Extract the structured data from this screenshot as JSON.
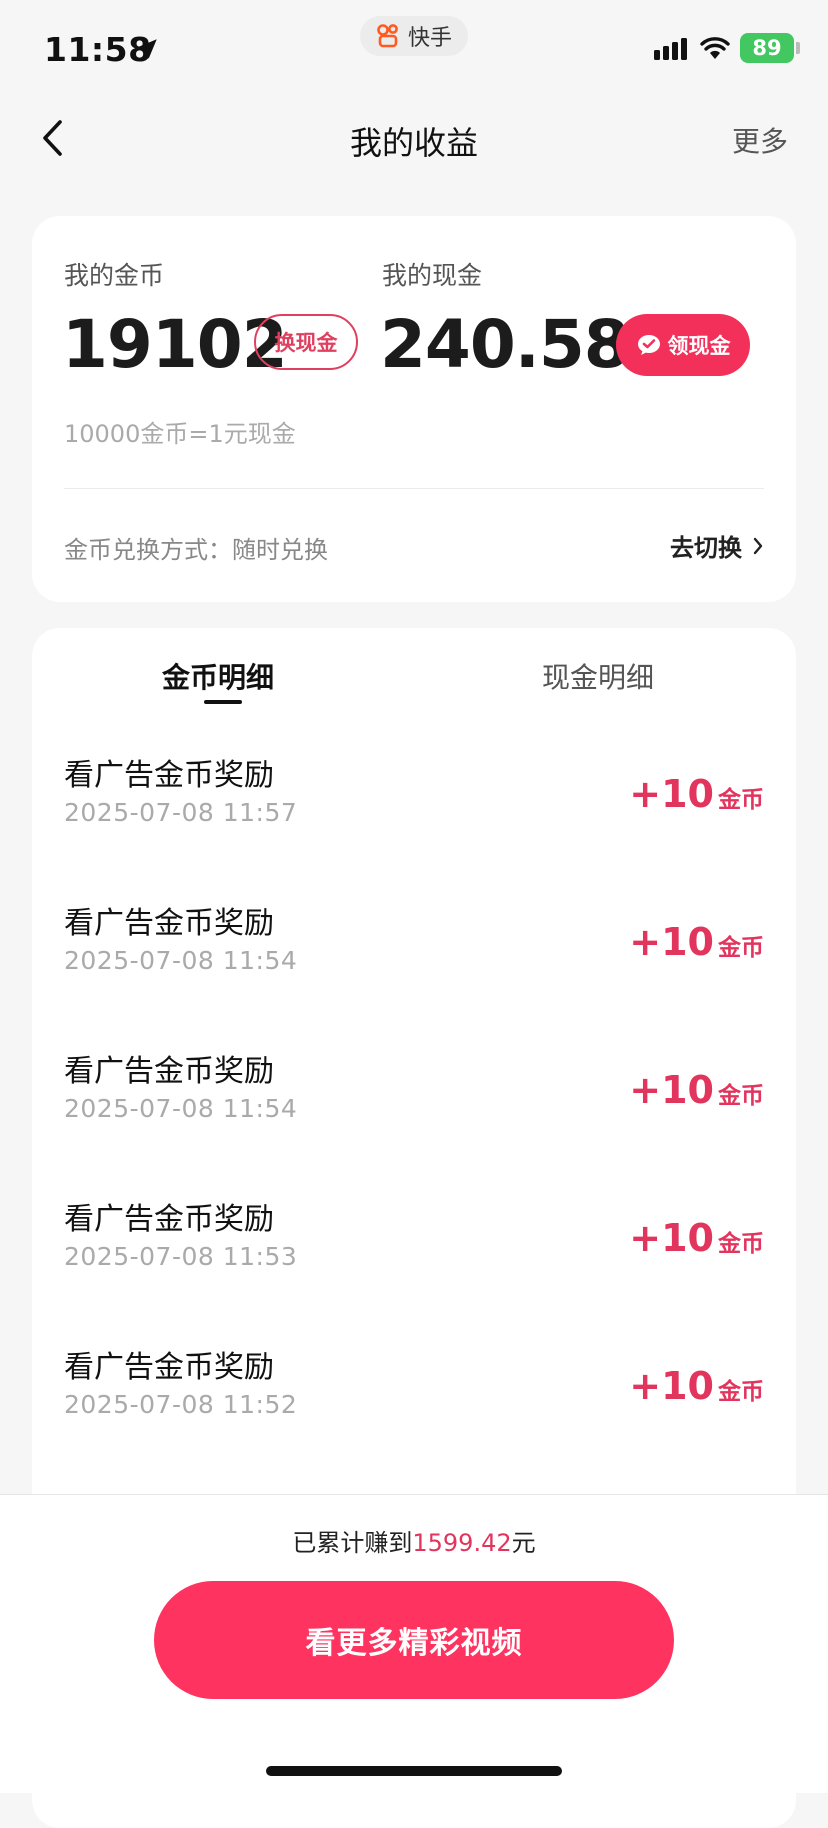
{
  "status_bar": {
    "time": "11:58",
    "app_name": "快手",
    "battery": "89"
  },
  "nav": {
    "title": "我的收益",
    "more": "更多"
  },
  "summary": {
    "coins_label": "我的金币",
    "coins_value": "19102",
    "exchange_btn": "换现金",
    "cash_label": "我的现金",
    "cash_value": "240.58",
    "withdraw_btn": "领现金",
    "rate_text": "10000金币=1元现金",
    "method_text": "金币兑换方式：随时兑换",
    "switch_text": "去切换"
  },
  "tabs": {
    "coins": "金币明细",
    "cash": "现金明细"
  },
  "records": [
    {
      "title": "看广告金币奖励",
      "time": "2025-07-08 11:57",
      "amount": "+10",
      "unit": "金币"
    },
    {
      "title": "看广告金币奖励",
      "time": "2025-07-08 11:54",
      "amount": "+10",
      "unit": "金币"
    },
    {
      "title": "看广告金币奖励",
      "time": "2025-07-08 11:54",
      "amount": "+10",
      "unit": "金币"
    },
    {
      "title": "看广告金币奖励",
      "time": "2025-07-08 11:53",
      "amount": "+10",
      "unit": "金币"
    },
    {
      "title": "看广告金币奖励",
      "time": "2025-07-08 11:52",
      "amount": "+10",
      "unit": "金币"
    }
  ],
  "bottom": {
    "earned_prefix": "已累计赚到",
    "earned_value": "1599.42",
    "earned_suffix": "元",
    "cta": "看更多精彩视频"
  },
  "colors": {
    "accent": "#fe3360",
    "amount": "#e2355e",
    "battery": "#43c760"
  }
}
